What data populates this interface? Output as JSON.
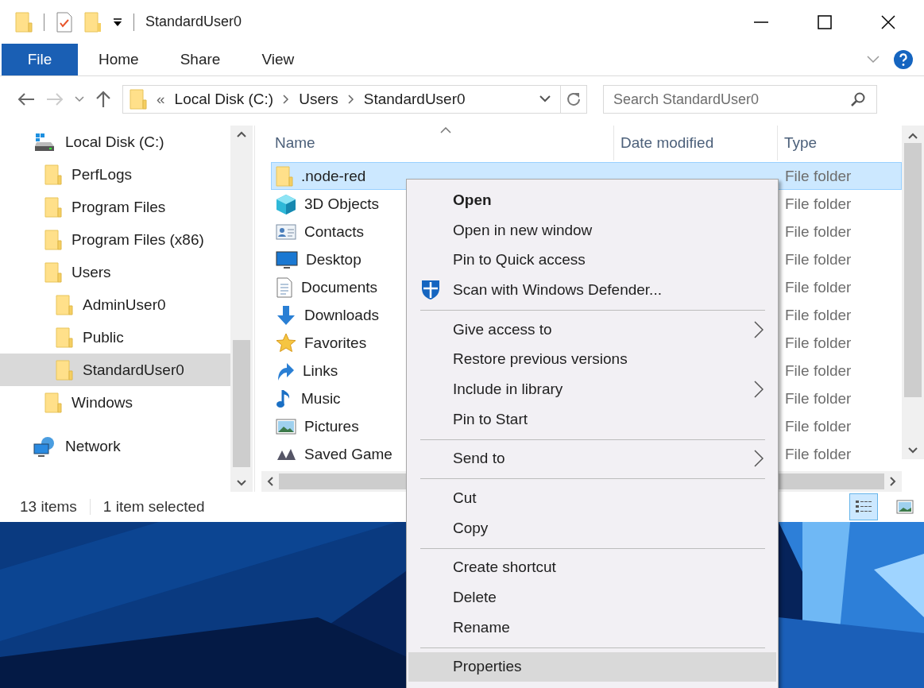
{
  "window": {
    "title": "StandardUser0"
  },
  "ribbon": {
    "tabs": [
      {
        "label": "File",
        "kind": "file",
        "selected": false
      },
      {
        "label": "Home",
        "kind": "tab",
        "selected": false
      },
      {
        "label": "Share",
        "kind": "tab",
        "selected": false
      },
      {
        "label": "View",
        "kind": "tab",
        "selected": false
      }
    ]
  },
  "address_bar": {
    "overflow": "«",
    "crumbs": [
      "Local Disk (C:)",
      "Users",
      "StandardUser0"
    ],
    "search_placeholder": "Search StandardUser0"
  },
  "navigation": {
    "items": [
      {
        "label": "Local Disk (C:)",
        "kind": "drive",
        "selected": false,
        "children": [
          {
            "label": "PerfLogs",
            "kind": "folder",
            "selected": false
          },
          {
            "label": "Program Files",
            "kind": "folder",
            "selected": false
          },
          {
            "label": "Program Files (x86)",
            "kind": "folder",
            "selected": false
          },
          {
            "label": "Users",
            "kind": "folder",
            "selected": false,
            "children": [
              {
                "label": "AdminUser0",
                "kind": "folder",
                "selected": false
              },
              {
                "label": "Public",
                "kind": "folder",
                "selected": false
              },
              {
                "label": "StandardUser0",
                "kind": "folder",
                "selected": true
              }
            ]
          },
          {
            "label": "Windows",
            "kind": "folder",
            "selected": false
          }
        ]
      },
      {
        "label": "Network",
        "kind": "network",
        "selected": false
      }
    ]
  },
  "file_list": {
    "columns": [
      "Name",
      "Date modified",
      "Type"
    ],
    "rows": [
      {
        "name": ".node-red",
        "type": "File folder",
        "kind": "folder",
        "selected": true
      },
      {
        "name": "3D Objects",
        "type": "File folder",
        "kind": "cube",
        "selected": false
      },
      {
        "name": "Contacts",
        "type": "File folder",
        "kind": "contacts",
        "selected": false
      },
      {
        "name": "Desktop",
        "type": "File folder",
        "kind": "desktop",
        "selected": false
      },
      {
        "name": "Documents",
        "type": "File folder",
        "kind": "documents",
        "selected": false
      },
      {
        "name": "Downloads",
        "type": "File folder",
        "kind": "downloads",
        "selected": false
      },
      {
        "name": "Favorites",
        "type": "File folder",
        "kind": "favorites",
        "selected": false
      },
      {
        "name": "Links",
        "type": "File folder",
        "kind": "links",
        "selected": false
      },
      {
        "name": "Music",
        "type": "File folder",
        "kind": "music",
        "selected": false
      },
      {
        "name": "Pictures",
        "type": "File folder",
        "kind": "pictures",
        "selected": false
      },
      {
        "name": "Saved Game",
        "type": "File folder",
        "kind": "games",
        "selected": false
      }
    ]
  },
  "status_bar": {
    "count": "13 items",
    "selection": "1 item selected",
    "views": [
      {
        "kind": "details",
        "selected": true
      },
      {
        "kind": "large-icons",
        "selected": false
      }
    ]
  },
  "context_menu": {
    "items": [
      {
        "kind": "item",
        "label": "Open",
        "default": true,
        "submenu": false,
        "selected": false
      },
      {
        "kind": "item",
        "label": "Open in new window",
        "default": false,
        "submenu": false,
        "selected": false
      },
      {
        "kind": "item",
        "label": "Pin to Quick access",
        "default": false,
        "submenu": false,
        "selected": false
      },
      {
        "kind": "shield-item",
        "label": "Scan with Windows Defender...",
        "default": false,
        "submenu": false,
        "selected": false
      },
      {
        "kind": "separator"
      },
      {
        "kind": "item",
        "label": "Give access to",
        "default": false,
        "submenu": true,
        "selected": false
      },
      {
        "kind": "item",
        "label": "Restore previous versions",
        "default": false,
        "submenu": false,
        "selected": false
      },
      {
        "kind": "item",
        "label": "Include in library",
        "default": false,
        "submenu": true,
        "selected": false
      },
      {
        "kind": "item",
        "label": "Pin to Start",
        "default": false,
        "submenu": false,
        "selected": false
      },
      {
        "kind": "separator"
      },
      {
        "kind": "item",
        "label": "Send to",
        "default": false,
        "submenu": true,
        "selected": false
      },
      {
        "kind": "separator"
      },
      {
        "kind": "item",
        "label": "Cut",
        "default": false,
        "submenu": false,
        "selected": false
      },
      {
        "kind": "item",
        "label": "Copy",
        "default": false,
        "submenu": false,
        "selected": false
      },
      {
        "kind": "separator"
      },
      {
        "kind": "item",
        "label": "Create shortcut",
        "default": false,
        "submenu": false,
        "selected": false
      },
      {
        "kind": "item",
        "label": "Delete",
        "default": false,
        "submenu": false,
        "selected": false
      },
      {
        "kind": "item",
        "label": "Rename",
        "default": false,
        "submenu": false,
        "selected": false
      },
      {
        "kind": "separator"
      },
      {
        "kind": "item",
        "label": "Properties",
        "default": false,
        "submenu": false,
        "selected": true
      }
    ]
  }
}
